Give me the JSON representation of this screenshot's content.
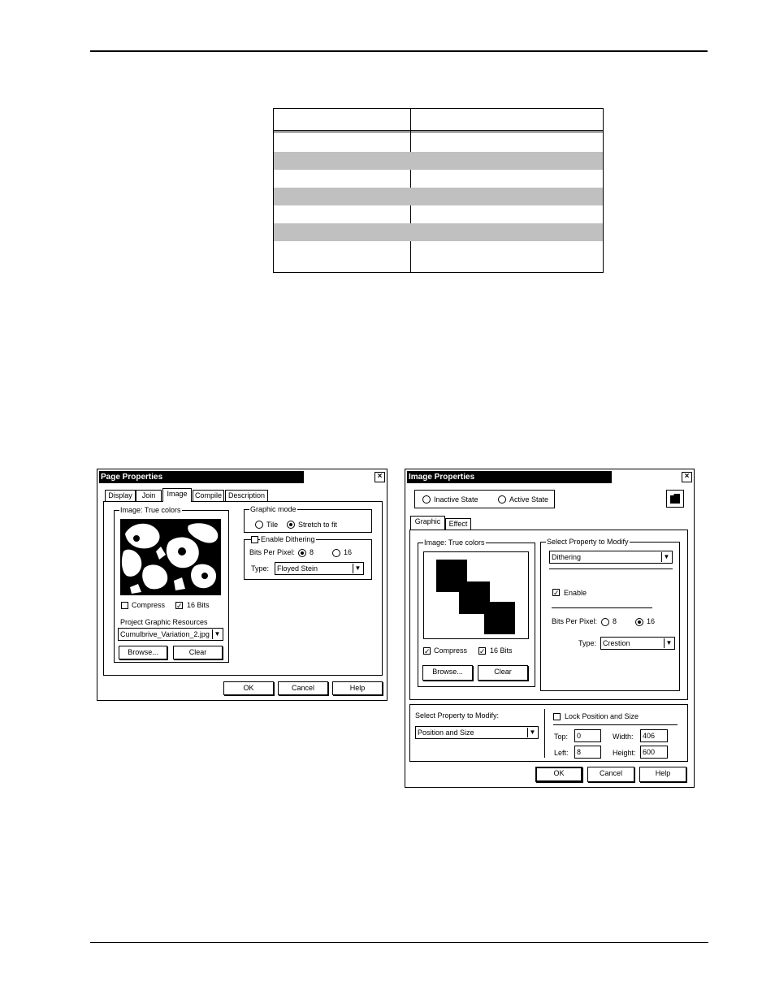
{
  "page_dialog": {
    "title": "Page Properties",
    "close": "×",
    "tabs": [
      "Display",
      "Join",
      "Image",
      "Compile",
      "Description"
    ],
    "image_group": "Image: True colors",
    "compress": "Compress",
    "bits16": "16 Bits",
    "resources_label": "Project Graphic Resources",
    "resource_value": "Cumulbrive_Variation_2.jpg",
    "browse": "Browse...",
    "clear": "Clear",
    "graphic_mode": "Graphic mode",
    "tile": "Tile",
    "stretch": "Stretch to fit",
    "enable_dithering": "Enable Dithering",
    "bits_per_pixel": "Bits Per Pixel:",
    "bpp8": "8",
    "bpp16": "16",
    "type_label": "Type:",
    "type_value": "Floyed Stein",
    "ok": "OK",
    "cancel": "Cancel",
    "help": "Help"
  },
  "image_dialog": {
    "title": "Image Properties",
    "close": "×",
    "inactive": "Inactive State",
    "active": "Active State",
    "tabs": [
      "Graphic",
      "Effect"
    ],
    "image_group": "Image: True colors",
    "compress": "Compress",
    "bits16": "16 Bits",
    "browse": "Browse...",
    "clear": "Clear",
    "select_group": "Select Property to Modify",
    "select_value": "Dithering",
    "enable": "Enable",
    "bits_per_pixel": "Bits Per Pixel:",
    "bpp8": "8",
    "bpp16": "16",
    "type_label": "Type:",
    "type_value": "Crestion",
    "bottom_select_label": "Select Property to Modify:",
    "bottom_select_value": "Position and Size",
    "lock": "Lock Position and Size",
    "top_label": "Top:",
    "top_value": "0",
    "left_label": "Left:",
    "left_value": "8",
    "width_label": "Width:",
    "width_value": "406",
    "height_label": "Height:",
    "height_value": "600",
    "ok": "OK",
    "cancel": "Cancel",
    "help": "Help"
  },
  "icons": {
    "folder": "folder-icon",
    "dropdown": "chevron-down-icon",
    "check": "✓"
  }
}
